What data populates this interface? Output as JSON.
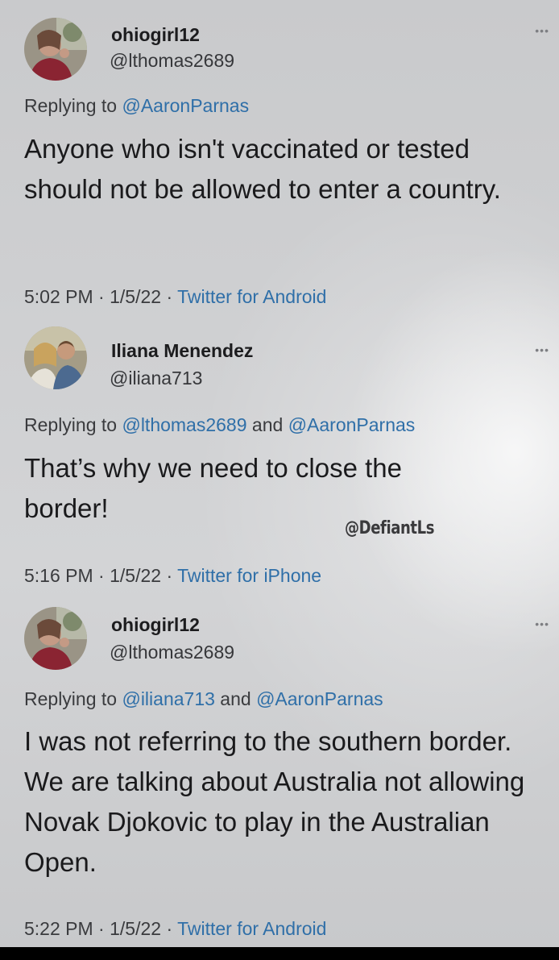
{
  "tweets": [
    {
      "name": "ohiogirl12",
      "handle": "@lthomas2689",
      "reply_prefix": "Replying to ",
      "reply_mentions": [
        "@AaronParnas"
      ],
      "reply_joiner": "",
      "body": "Anyone who isn't vaccinated or tested should not be allowed to enter a country.",
      "time": "5:02 PM",
      "date": "1/5/22",
      "source": "Twitter for Android",
      "separator": " · ",
      "more_icon": "more-dots-icon"
    },
    {
      "name": "Iliana Menendez",
      "handle": "@iliana713",
      "reply_prefix": "Replying to ",
      "reply_mentions": [
        "@lthomas2689",
        "@AaronParnas"
      ],
      "reply_joiner": " and ",
      "body": "That’s why we need to close the border!",
      "time": "5:16 PM",
      "date": "1/5/22",
      "source": "Twitter for iPhone",
      "separator": " · ",
      "more_icon": "more-dots-icon"
    },
    {
      "name": "ohiogirl12",
      "handle": "@lthomas2689",
      "reply_prefix": "Replying to ",
      "reply_mentions": [
        "@iliana713",
        "@AaronParnas"
      ],
      "reply_joiner": " and ",
      "body": "I was not referring to the southern border. We are talking about Australia not allowing Novak Djokovic to play in the Australian Open.",
      "time": "5:22 PM",
      "date": "1/5/22",
      "source": "Twitter for Android",
      "separator": " · ",
      "more_icon": "more-dots-icon"
    }
  ],
  "watermark": "@DefiantLs",
  "more_glyph": "•••",
  "colors": {
    "mention": "#2f6fa8",
    "text": "#1a1a1c",
    "background": "#cfd0d2"
  }
}
